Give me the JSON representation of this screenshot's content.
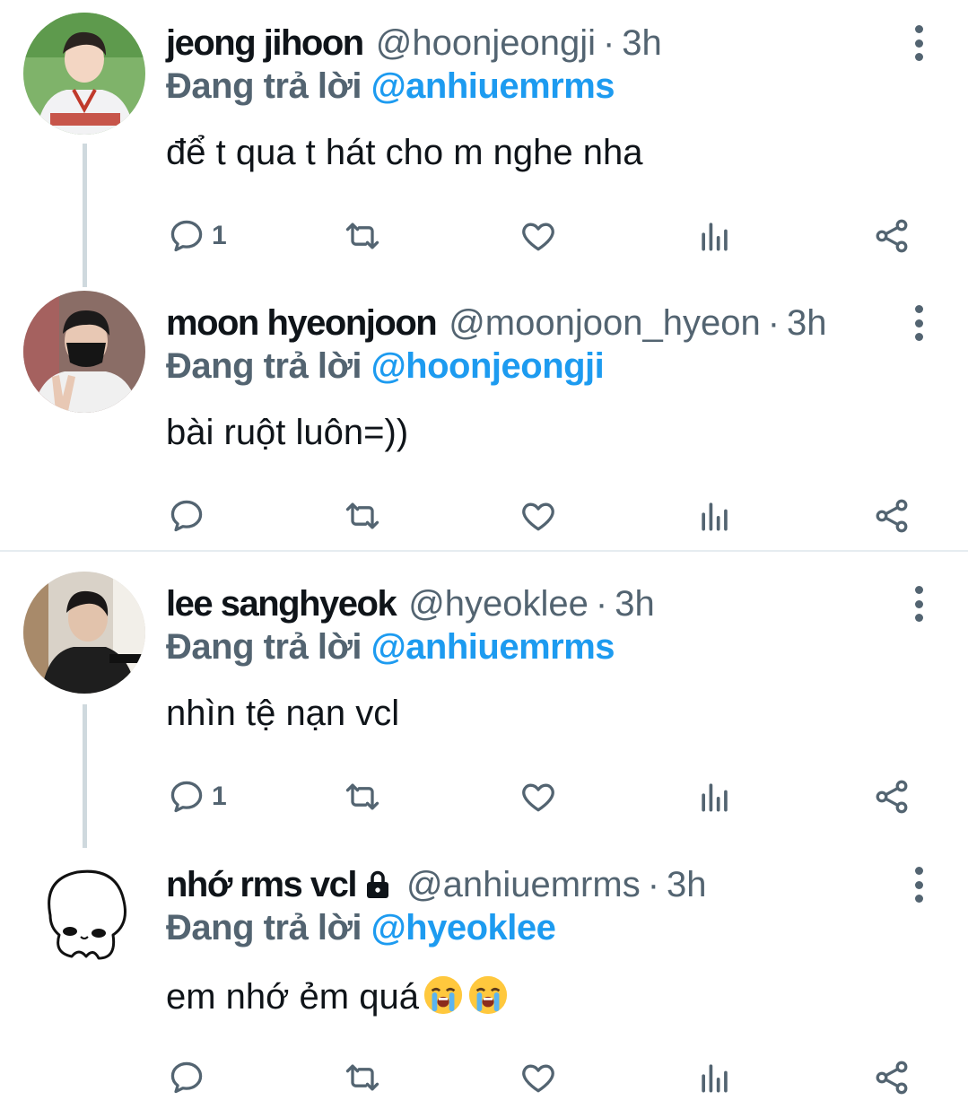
{
  "colors": {
    "accent": "#1d9bf0",
    "muted": "#536471",
    "text": "#0f1419"
  },
  "reply_prefix": "Đang trả lời",
  "tweets": [
    {
      "name": "jeong jihoon",
      "handle": "@hoonjeongji",
      "dot": "·",
      "time": "3h",
      "mention": "@anhiuemrms",
      "text": "để t qua t hát cho m nghe nha",
      "reply_count": "1",
      "locked": false,
      "avatar": "avatar-photo-baseball-jersey"
    },
    {
      "name": "moon hyeonjoon",
      "handle": "@moonjoon_hyeon",
      "dot": "·",
      "time": "3h",
      "mention": "@hoonjeongji",
      "text": "bài ruột luôn=))",
      "reply_count": "",
      "locked": false,
      "avatar": "avatar-photo-masked"
    },
    {
      "name": "lee sanghyeok",
      "handle": "@hyeoklee",
      "dot": "·",
      "time": "3h",
      "mention": "@anhiuemrms",
      "text": "nhìn tệ nạn vcl",
      "reply_count": "1",
      "locked": false,
      "avatar": "avatar-photo-piano"
    },
    {
      "name": "nhớ rms vcl",
      "handle": "@anhiuemrms",
      "dot": "·",
      "time": "3h",
      "mention": "@hyeoklee",
      "text": "em nhớ ẻm quá",
      "emojis": [
        "loudly-crying-face",
        "loudly-crying-face"
      ],
      "reply_count": "",
      "locked": true,
      "avatar": "avatar-drawing-cartoon"
    }
  ]
}
